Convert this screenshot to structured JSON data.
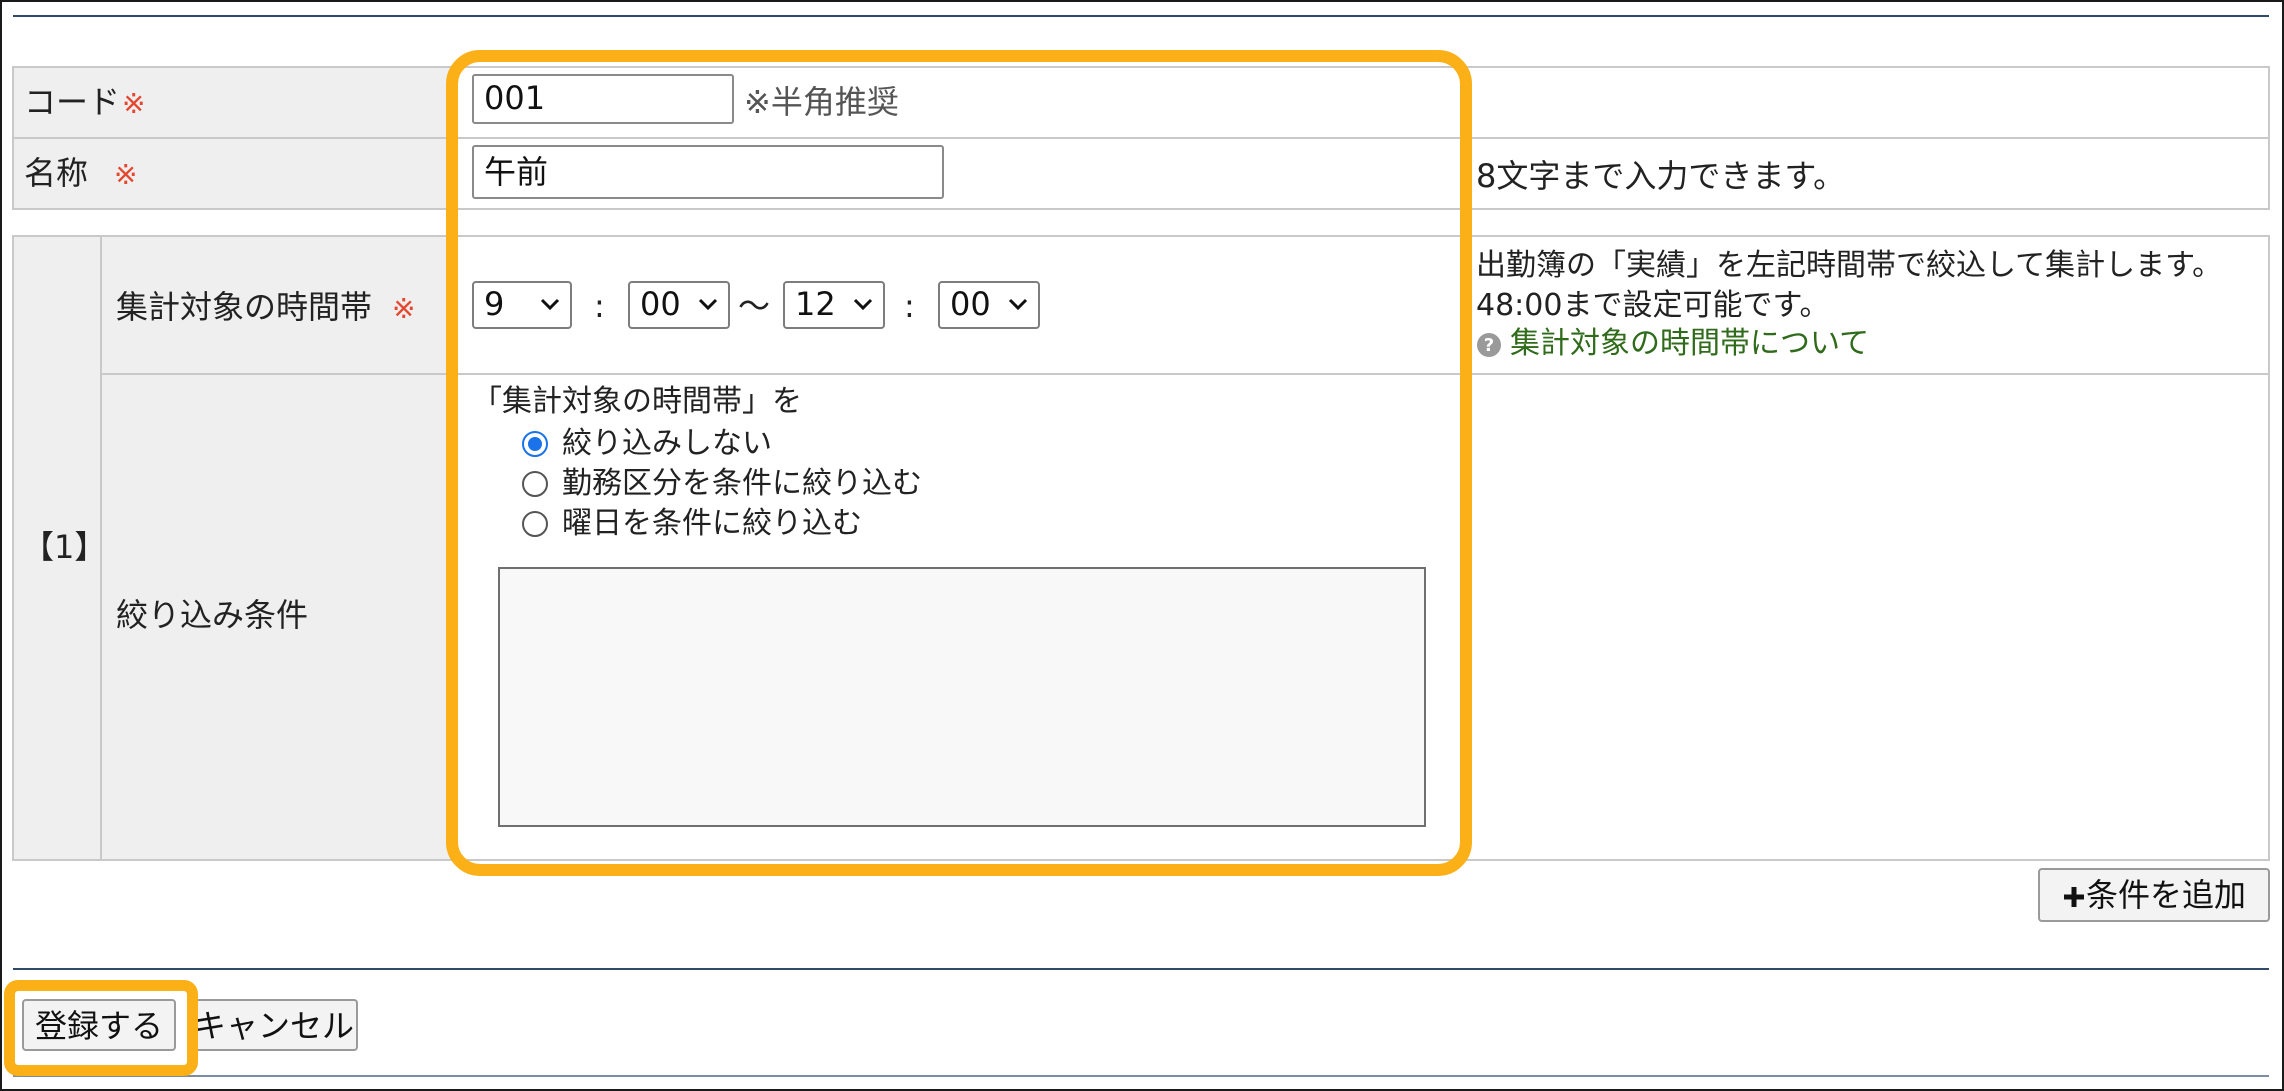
{
  "form": {
    "code": {
      "label": "コード",
      "required_mark": "※",
      "value": "001",
      "hint": "※半角推奨"
    },
    "name": {
      "label": "名称",
      "required_mark": "※",
      "value": "午前",
      "note": "8文字まで入力できます。"
    }
  },
  "condition_block": {
    "index_label": "【1】",
    "time_range": {
      "label": "集計対象の時間帯",
      "required_mark": "※",
      "start_hour": "9",
      "start_minute": "00",
      "end_hour": "12",
      "end_minute": "00",
      "colon": ":",
      "tilde": "～",
      "note_line1": "出勤簿の「実績」を左記時間帯で絞込して集計します。",
      "note_line2": "48:00まで設定可能です。",
      "help_link": "集計対象の時間帯について"
    },
    "filter": {
      "label": "絞り込み条件",
      "heading": "「集計対象の時間帯」を",
      "options": [
        {
          "label": "絞り込みしない",
          "selected": true
        },
        {
          "label": "勤務区分を条件に絞り込む",
          "selected": false
        },
        {
          "label": "曜日を条件に絞り込む",
          "selected": false
        }
      ]
    }
  },
  "buttons": {
    "add_condition": "条件を追加",
    "register": "登録する",
    "cancel": "キャンセル"
  },
  "colors": {
    "highlight": "#fbb018",
    "required": "#e4472e",
    "link": "#2f6b1a",
    "radio_selected": "#1a73e8"
  }
}
